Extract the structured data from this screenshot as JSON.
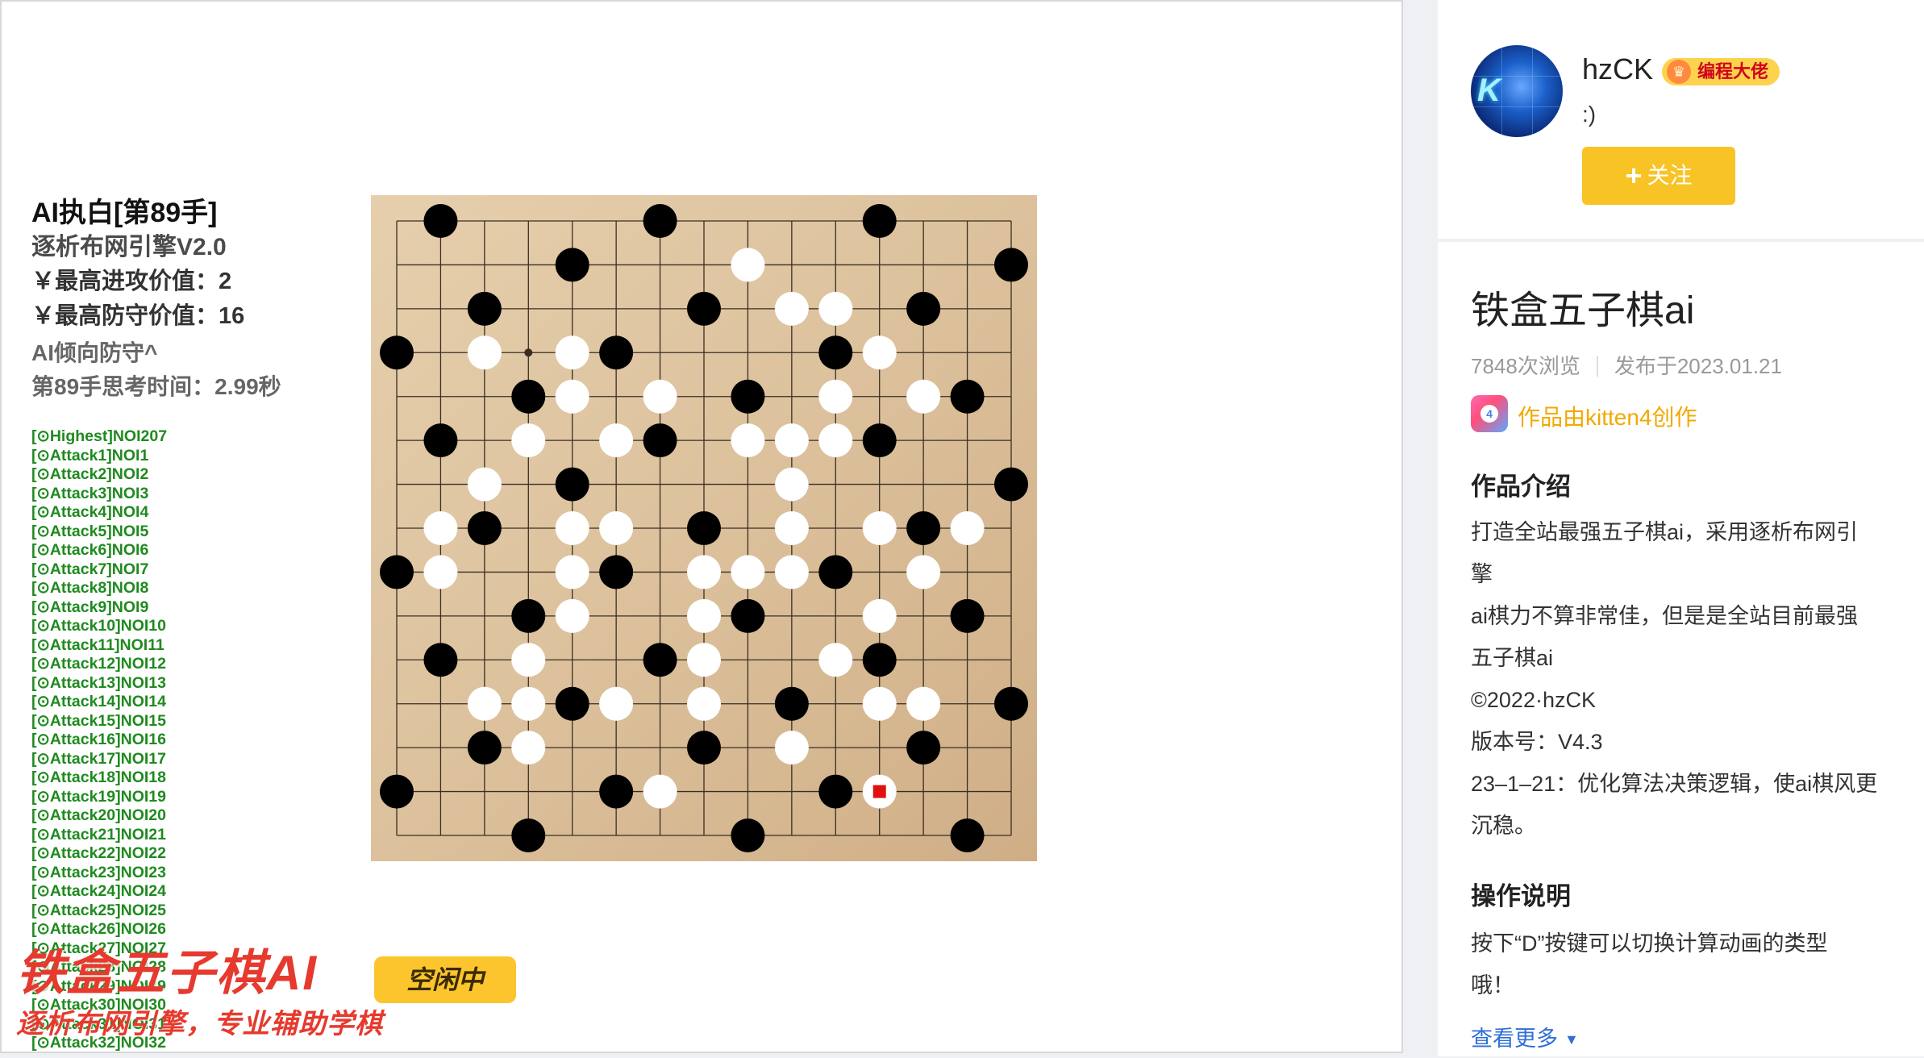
{
  "game": {
    "ai_title": "AI执白[第89手]",
    "engine": "逐析布网引擎V2.0",
    "attack_value": "￥最高进攻价值：2",
    "defense_value": "￥最高防守价值：16",
    "tendency": "AI倾向防守^",
    "think_time": "第89手思考时间：2.99秒",
    "attack_list": [
      "[⊙Highest]NOI207",
      "[⊙Attack1]NOI1",
      "[⊙Attack2]NOI2",
      "[⊙Attack3]NOI3",
      "[⊙Attack4]NOI4",
      "[⊙Attack5]NOI5",
      "[⊙Attack6]NOI6",
      "[⊙Attack7]NOI7",
      "[⊙Attack8]NOI8",
      "[⊙Attack9]NOI9",
      "[⊙Attack10]NOI10",
      "[⊙Attack11]NOI11",
      "[⊙Attack12]NOI12",
      "[⊙Attack13]NOI13",
      "[⊙Attack14]NOI14",
      "[⊙Attack15]NOI15",
      "[⊙Attack16]NOI16",
      "[⊙Attack17]NOI17",
      "[⊙Attack18]NOI18",
      "[⊙Attack19]NOI19",
      "[⊙Attack20]NOI20",
      "[⊙Attack21]NOI21",
      "[⊙Attack22]NOI22",
      "[⊙Attack23]NOI23",
      "[⊙Attack24]NOI24",
      "[⊙Attack25]NOI25",
      "[⊙Attack26]NOI26",
      "[⊙Attack27]NOI27",
      "[⊙Attack28]NOI28",
      "[⊙Attack29]NOI29",
      "[⊙Attack30]NOI30",
      "[⊙Attack31]NOI31",
      "[⊙Attack32]NOI32"
    ],
    "board": {
      "size": 15,
      "colors": {
        "board": "#dcc19c",
        "line": "#3a2e22",
        "black": "#000000",
        "white": "#ffffff",
        "last_move": "#e01010"
      },
      "black_stones": [
        [
          1,
          0
        ],
        [
          6,
          0
        ],
        [
          11,
          0
        ],
        [
          4,
          1
        ],
        [
          14,
          1
        ],
        [
          2,
          2
        ],
        [
          7,
          2
        ],
        [
          12,
          2
        ],
        [
          0,
          3
        ],
        [
          5,
          3
        ],
        [
          10,
          3
        ],
        [
          3,
          4
        ],
        [
          8,
          4
        ],
        [
          13,
          4
        ],
        [
          1,
          5
        ],
        [
          6,
          5
        ],
        [
          11,
          5
        ],
        [
          4,
          6
        ],
        [
          9,
          6
        ],
        [
          14,
          6
        ],
        [
          2,
          7
        ],
        [
          7,
          7
        ],
        [
          12,
          7
        ],
        [
          0,
          8
        ],
        [
          5,
          8
        ],
        [
          10,
          8
        ],
        [
          3,
          9
        ],
        [
          8,
          9
        ],
        [
          13,
          9
        ],
        [
          1,
          10
        ],
        [
          6,
          10
        ],
        [
          11,
          10
        ],
        [
          4,
          11
        ],
        [
          9,
          11
        ],
        [
          14,
          11
        ],
        [
          2,
          12
        ],
        [
          7,
          12
        ],
        [
          12,
          12
        ],
        [
          0,
          13
        ],
        [
          5,
          13
        ],
        [
          10,
          13
        ],
        [
          3,
          14
        ],
        [
          8,
          14
        ],
        [
          13,
          14
        ]
      ],
      "white_stones": [
        [
          8,
          1
        ],
        [
          9,
          2
        ],
        [
          10,
          2
        ],
        [
          2,
          3
        ],
        [
          4,
          3
        ],
        [
          11,
          3
        ],
        [
          4,
          4
        ],
        [
          6,
          4
        ],
        [
          10,
          4
        ],
        [
          12,
          4
        ],
        [
          3,
          5
        ],
        [
          5,
          5
        ],
        [
          8,
          5
        ],
        [
          9,
          5
        ],
        [
          10,
          5
        ],
        [
          2,
          6
        ],
        [
          9,
          6
        ],
        [
          1,
          7
        ],
        [
          4,
          7
        ],
        [
          5,
          7
        ],
        [
          9,
          7
        ],
        [
          11,
          7
        ],
        [
          13,
          7
        ],
        [
          1,
          8
        ],
        [
          4,
          8
        ],
        [
          7,
          8
        ],
        [
          8,
          8
        ],
        [
          9,
          8
        ],
        [
          12,
          8
        ],
        [
          4,
          9
        ],
        [
          7,
          9
        ],
        [
          11,
          9
        ],
        [
          3,
          10
        ],
        [
          7,
          10
        ],
        [
          10,
          10
        ],
        [
          2,
          11
        ],
        [
          3,
          11
        ],
        [
          5,
          11
        ],
        [
          7,
          11
        ],
        [
          11,
          11
        ],
        [
          12,
          11
        ],
        [
          3,
          12
        ],
        [
          9,
          12
        ],
        [
          6,
          13
        ],
        [
          11,
          13
        ]
      ],
      "last_move": [
        11,
        13
      ],
      "star_points": [
        [
          3,
          3
        ]
      ]
    },
    "brand": {
      "title": "铁盒五子棋AI",
      "badge": "空闲中",
      "subtitle": "逐析布网引擎，专业辅助学棋"
    }
  },
  "author": {
    "name": "hzCK",
    "badge": "编程大佬",
    "signature": ":)",
    "follow_label": "关注",
    "avatar_letter": "K"
  },
  "work": {
    "title": "铁盒五子棋ai",
    "views": "7848次浏览",
    "published": "发布于2023.01.21",
    "made_with": "作品由kitten4创作",
    "intro_title": "作品介绍",
    "intro_lines": [
      "打造全站最强五子棋ai，采用逐析布网引",
      "擎",
      "ai棋力不算非常佳，但是是全站目前最强",
      "五子棋ai",
      "©2022·hzCK",
      "版本号：V4.3",
      "23–1–21：优化算法决策逻辑，使ai棋风更",
      "沉稳。"
    ],
    "ops_title": "操作说明",
    "ops_lines": [
      "按下“D”按键可以切换计算动画的类型",
      "哦！"
    ],
    "see_more": "查看更多"
  }
}
